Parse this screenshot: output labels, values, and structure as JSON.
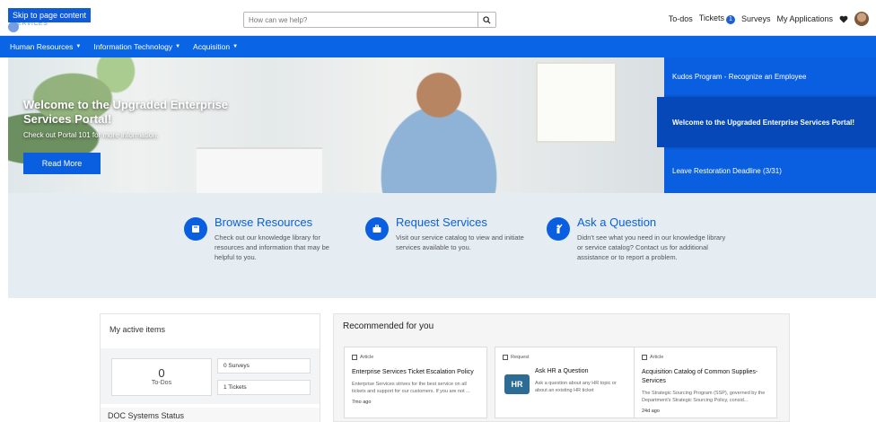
{
  "header": {
    "skip_link": "Skip to page content",
    "logo_fragment": "SERVICES",
    "search_placeholder": "How can we help?",
    "nav": {
      "todos": "To-dos",
      "tickets": "Tickets",
      "tickets_count": "1",
      "surveys": "Surveys",
      "my_applications": "My Applications"
    }
  },
  "mainnav": {
    "items": [
      {
        "label": "Human Resources"
      },
      {
        "label": "Information Technology"
      },
      {
        "label": "Acquisition"
      }
    ]
  },
  "hero": {
    "title": "Welcome to the Upgraded Enterprise Services Portal!",
    "subtitle": "Check out Portal 101 for more information.",
    "button": "Read More"
  },
  "slides": [
    {
      "label": "Kudos Program - Recognize an Employee"
    },
    {
      "label": "Welcome to the Upgraded Enterprise Services Portal!"
    },
    {
      "label": "Leave Restoration Deadline (3/31)"
    }
  ],
  "features": [
    {
      "title": "Browse Resources",
      "text": "Check out our knowledge library for resources and information that may be helpful to you."
    },
    {
      "title": "Request Services",
      "text": "Visit our service catalog to view and initiate services available to you."
    },
    {
      "title": "Ask a Question",
      "text": "Didn't see what you need in our knowledge library or service catalog? Contact us for additional assistance or to report a problem."
    }
  ],
  "active_items": {
    "title": "My active items",
    "todo_count": "0",
    "todo_label": "To-Dos",
    "surveys_line": "0 Surveys",
    "tickets_line": "1 Tickets",
    "doc_status": "DOC Systems Status"
  },
  "recommended": {
    "title": "Recommended for you",
    "items": [
      {
        "type": "Article",
        "title": "Enterprise Services Ticket Escalation Policy",
        "desc": "Enterprise Services strives for the best service on all tickets and support for our customers. If you are not ...",
        "age": "7mo ago"
      },
      {
        "type": "Request",
        "title": "Ask HR a Question",
        "desc": "Ask a question about any HR topic or about an existing HR ticket",
        "icon_text": "HR"
      },
      {
        "type": "Article",
        "title": "Acquisition Catalog of Common Supplies-Services",
        "desc": "The Strategic Sourcing Program (SSP), governed by the Department's Strategic Sourcing Policy, consid...",
        "age": "24d ago"
      }
    ]
  }
}
